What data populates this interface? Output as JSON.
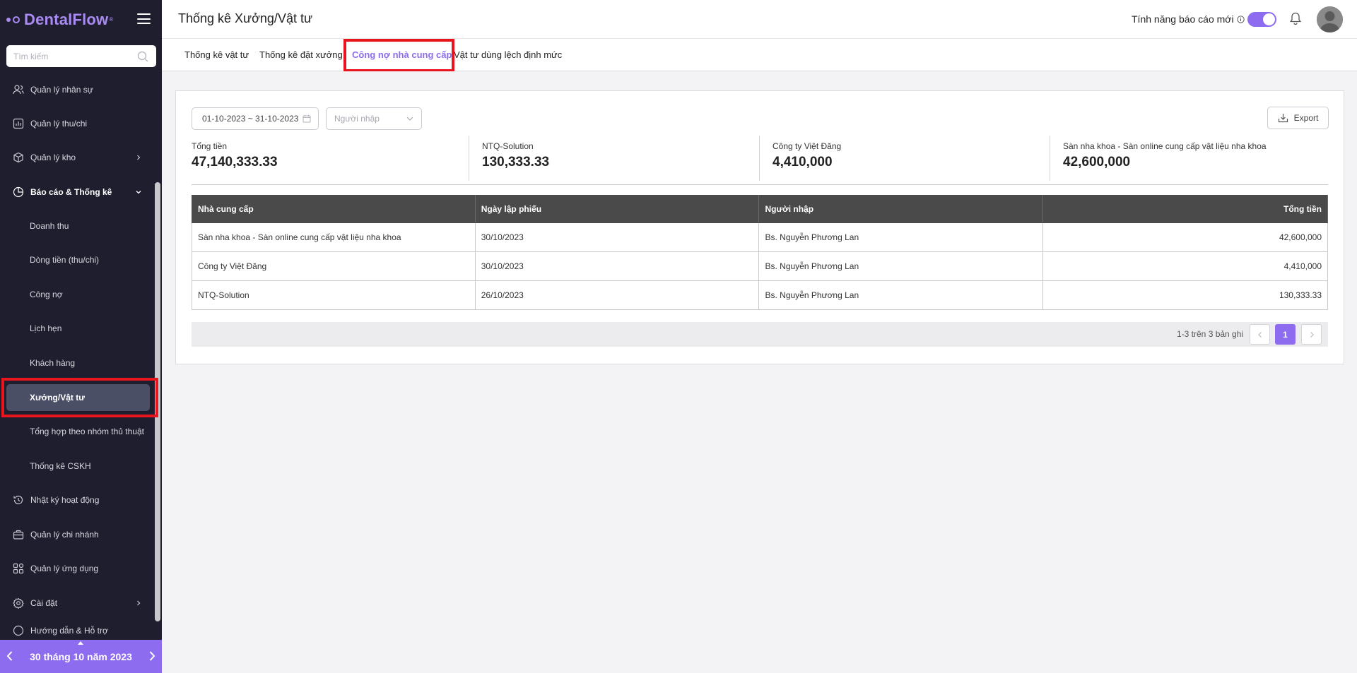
{
  "sidebar": {
    "logo": "DentalFlow",
    "logo_mark": "®",
    "search_placeholder": "Tìm kiếm",
    "items": [
      {
        "label": "Quản lý nhân sự",
        "icon": "users-icon"
      },
      {
        "label": "Quản lý thu/chi",
        "icon": "chart-icon"
      },
      {
        "label": "Quản lý kho",
        "icon": "box-icon"
      },
      {
        "label": "Báo cáo & Thống kê",
        "icon": "pie-chart-icon"
      },
      {
        "label": "Nhật ký hoạt động",
        "icon": "history-icon"
      },
      {
        "label": "Quản lý chi nhánh",
        "icon": "building-icon"
      },
      {
        "label": "Quản lý ứng dụng",
        "icon": "apps-icon"
      },
      {
        "label": "Cài đặt",
        "icon": "gear-icon"
      },
      {
        "label": "Hướng dẫn & Hỗ trợ",
        "icon": "help-icon"
      }
    ],
    "sub_items": [
      "Doanh thu",
      "Dòng tiền (thu/chi)",
      "Công nợ",
      "Lịch hẹn",
      "Khách hàng",
      "Xưởng/Vật tư",
      "Tổng hợp theo nhóm thủ thuật",
      "Thống kê CSKH"
    ],
    "footer_date": "30 tháng 10 năm 2023"
  },
  "header": {
    "title": "Thống kê Xưởng/Vật tư",
    "feature_label": "Tính năng báo cáo mới"
  },
  "tabs": [
    "Thống kê vật tư",
    "Thống kê đặt xưởng",
    "Công nợ nhà cung cấp",
    "Vật tư dùng lệch định mức"
  ],
  "filters": {
    "date_range": "01-10-2023 ~ 31-10-2023",
    "importer_placeholder": "Người nhập",
    "export_label": "Export"
  },
  "stats": [
    {
      "label": "Tổng tiền",
      "value": "47,140,333.33"
    },
    {
      "label": "NTQ-Solution",
      "value": "130,333.33"
    },
    {
      "label": "Công ty Việt Đăng",
      "value": "4,410,000"
    },
    {
      "label": "Sàn nha khoa - Sàn online cung cấp vật liệu nha khoa",
      "value": "42,600,000"
    }
  ],
  "table": {
    "headers": [
      "Nhà cung cấp",
      "Ngày lập phiếu",
      "Người nhập",
      "Tổng tiền"
    ],
    "rows": [
      [
        "Sàn nha khoa - Sàn online cung cấp vật liệu nha khoa",
        "30/10/2023",
        "Bs. Nguyễn Phương Lan",
        "42,600,000"
      ],
      [
        "Công ty Việt Đăng",
        "30/10/2023",
        "Bs. Nguyễn Phương Lan",
        "4,410,000"
      ],
      [
        "NTQ-Solution",
        "26/10/2023",
        "Bs. Nguyễn Phương Lan",
        "130,333.33"
      ]
    ]
  },
  "pagination": {
    "summary": "1-3 trên 3 bản ghi",
    "current_page": "1"
  },
  "colors": {
    "accent": "#8e6cf0",
    "sidebar_bg": "#1f1e2e",
    "highlight": "#e8141e"
  }
}
